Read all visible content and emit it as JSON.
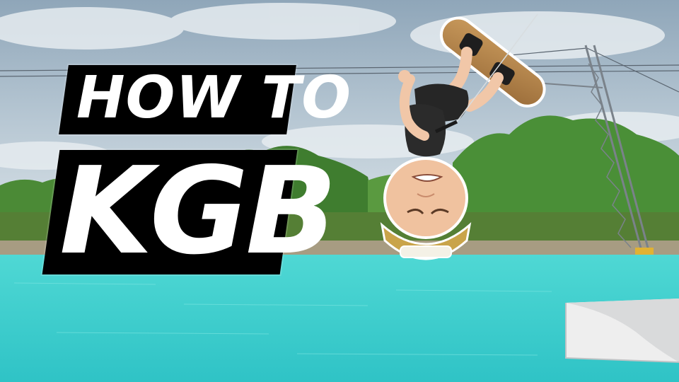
{
  "title": {
    "line1": "HOW TO",
    "line2": "KGB"
  },
  "hat_label": "",
  "colors": {
    "water": "#3fd0cf",
    "sky": "#a9bccb",
    "trees": "#4f8a3a",
    "board": "#b8894f",
    "title_text": "#ffffff",
    "title_plate": "#000000"
  }
}
